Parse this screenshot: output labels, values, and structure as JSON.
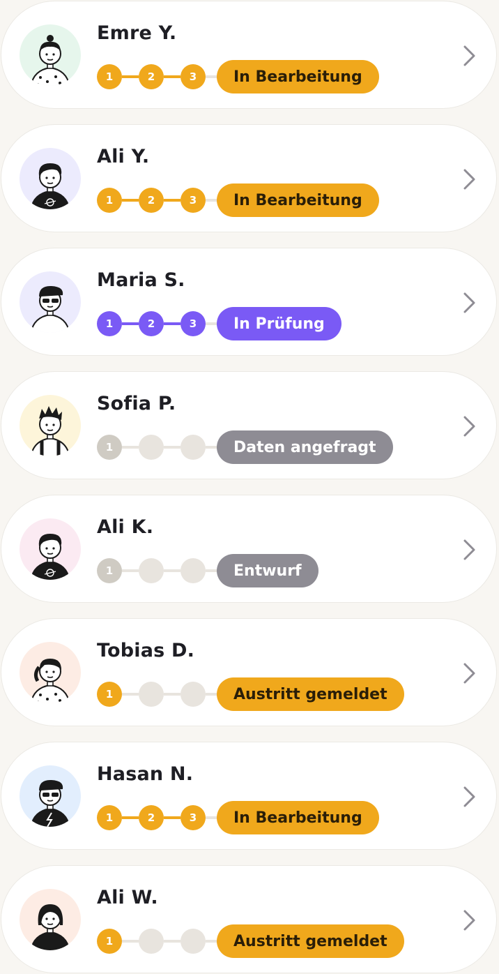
{
  "colors": {
    "orange": "#f0a81c",
    "purple": "#7a5af5",
    "gray_badge": "#8e8c94",
    "gray_step_done": "#cfcbc3",
    "gray_step_empty": "#e8e4de",
    "chevron": "#8e8c94"
  },
  "employees": [
    {
      "name": "Emre Y.",
      "status": "In Bearbeitung",
      "variant": "orange",
      "completed": 3,
      "steps": [
        "1",
        "2",
        "3"
      ],
      "avatar_bg": "#e6f6ec",
      "avatar": "person-bun-dotted-shirt-avatar"
    },
    {
      "name": "Ali Y.",
      "status": "In Bearbeitung",
      "variant": "orange",
      "completed": 3,
      "steps": [
        "1",
        "2",
        "3"
      ],
      "avatar_bg": "#ecebfd",
      "avatar": "person-planet-shirt-avatar"
    },
    {
      "name": "Maria S.",
      "status": "In Prüfung",
      "variant": "purple",
      "completed": 3,
      "steps": [
        "1",
        "2",
        "3"
      ],
      "avatar_bg": "#ecebfd",
      "avatar": "person-sunglasses-hoodie-avatar"
    },
    {
      "name": "Sofia P.",
      "status": "Daten angefragt",
      "variant": "gray",
      "completed": 1,
      "steps": [
        "1",
        "",
        ""
      ],
      "avatar_bg": "#fdf5da",
      "avatar": "person-spiky-hair-suspenders-avatar"
    },
    {
      "name": "Ali K.",
      "status": "Entwurf",
      "variant": "gray",
      "completed": 1,
      "steps": [
        "1",
        "",
        ""
      ],
      "avatar_bg": "#fbeaf2",
      "avatar": "person-planet-shirt-jacket-avatar"
    },
    {
      "name": "Tobias D.",
      "status": "Austritt gemeldet",
      "variant": "orange",
      "completed": 1,
      "steps": [
        "1",
        "",
        ""
      ],
      "avatar_bg": "#fdece4",
      "avatar": "person-ponytail-dotted-shirt-avatar"
    },
    {
      "name": "Hasan N.",
      "status": "In Bearbeitung",
      "variant": "orange",
      "completed": 3,
      "steps": [
        "1",
        "2",
        "3"
      ],
      "avatar_bg": "#e2eefd",
      "avatar": "person-sunglasses-bolt-shirt-avatar"
    },
    {
      "name": "Ali W.",
      "status": "Austritt gemeldet",
      "variant": "orange",
      "completed": 1,
      "steps": [
        "1",
        "",
        ""
      ],
      "avatar_bg": "#fdece4",
      "avatar": "person-long-hair-black-shirt-avatar"
    }
  ]
}
